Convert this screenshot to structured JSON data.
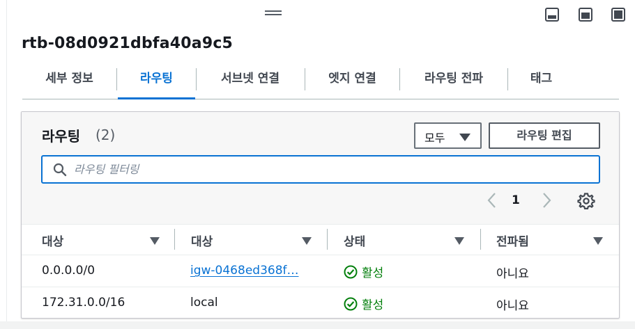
{
  "detail": {
    "route_table_id": "rtb-08d0921dbfa40a9c5"
  },
  "tabs": [
    {
      "label": "세부 정보",
      "active": false
    },
    {
      "label": "라우팅",
      "active": true
    },
    {
      "label": "서브넷 연결",
      "active": false
    },
    {
      "label": "엣지 연결",
      "active": false
    },
    {
      "label": "라우팅 전파",
      "active": false
    },
    {
      "label": "태그",
      "active": false
    }
  ],
  "routes_panel": {
    "title": "라우팅",
    "count": "(2)",
    "select_value": "모두",
    "edit_button": "라우팅 편집",
    "filter_placeholder": "라우팅 필터링",
    "filter_value": "",
    "current_page": "1",
    "columns": [
      "대상",
      "대상",
      "상태",
      "전파됨"
    ],
    "rows": [
      {
        "destination": "0.0.0.0/0",
        "target": "igw-0468ed368f…",
        "target_is_link": true,
        "status": "활성",
        "propagated": "아니요"
      },
      {
        "destination": "172.31.0.0/16",
        "target": "local",
        "target_is_link": false,
        "status": "활성",
        "propagated": "아니요"
      }
    ]
  },
  "colors": {
    "accent": "#0972d3",
    "success": "#037f0c",
    "text": "#16191f"
  },
  "icons": [
    "drag-handle-icon",
    "layout-bottom-icon",
    "layout-side-icon",
    "layout-full-icon",
    "search-icon",
    "chevron-left-icon",
    "chevron-right-icon",
    "gear-icon",
    "sort-caret-icon",
    "status-success-icon"
  ]
}
